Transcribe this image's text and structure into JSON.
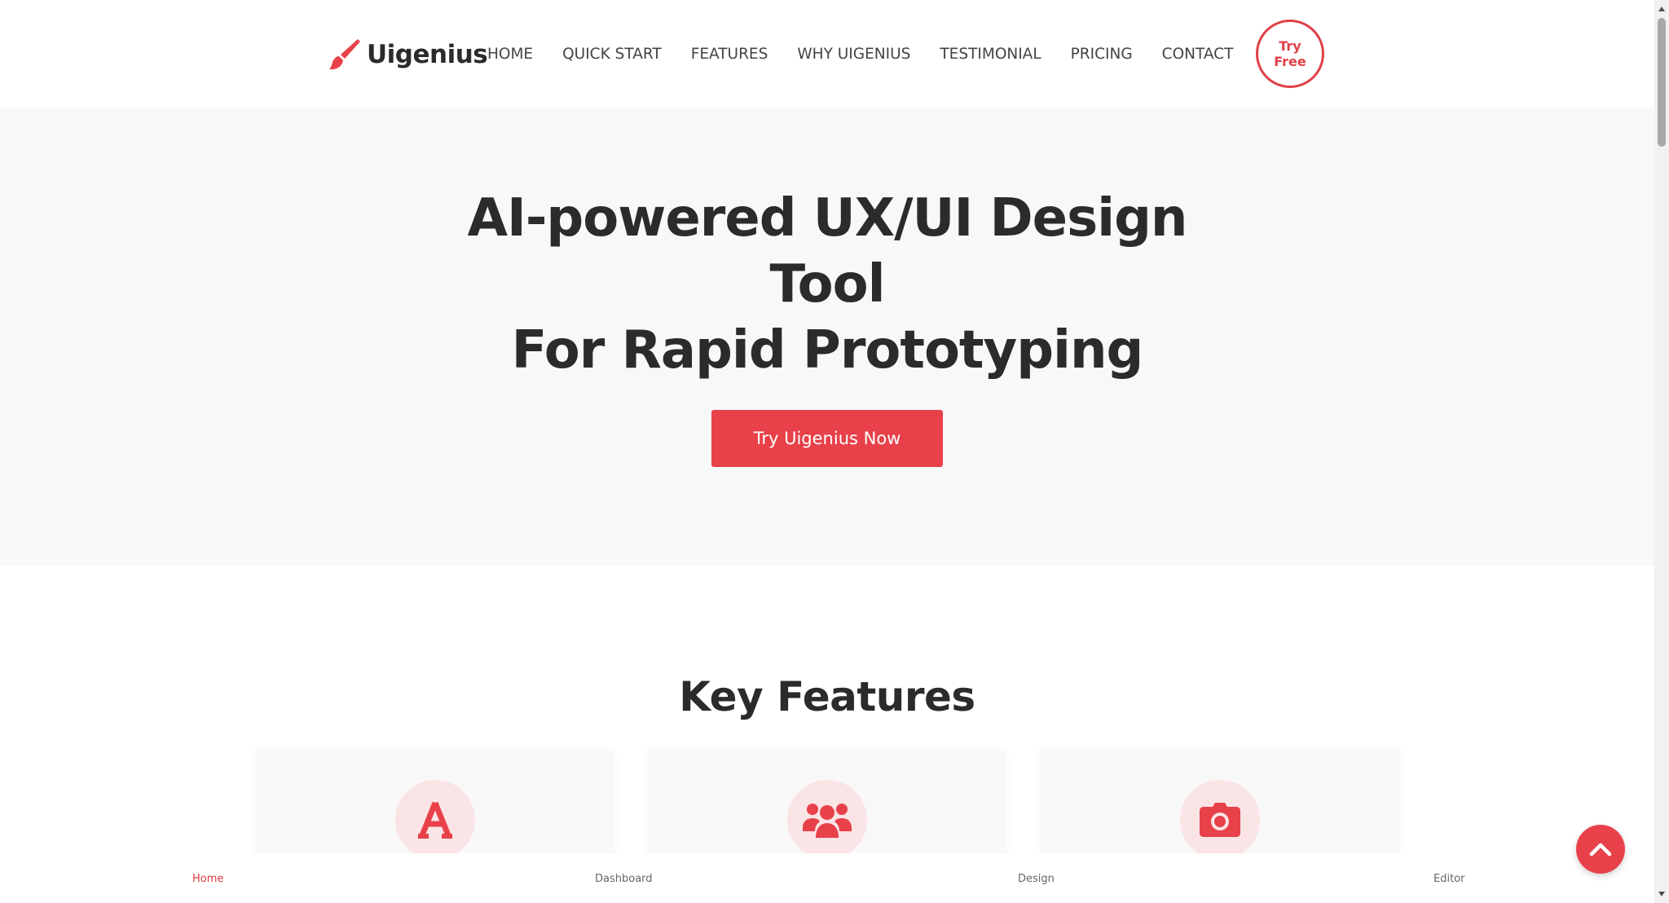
{
  "brand": {
    "name": "Uigenius",
    "accent_color": "#e8414a",
    "logo_icon": "paintbrush-icon"
  },
  "nav": {
    "items": [
      {
        "label": "HOME"
      },
      {
        "label": "QUICK START"
      },
      {
        "label": "FEATURES"
      },
      {
        "label": "WHY UIGENIUS"
      },
      {
        "label": "TESTIMONIAL"
      },
      {
        "label": "PRICING"
      },
      {
        "label": "CONTACT"
      }
    ],
    "try_free_label": "Try Free"
  },
  "hero": {
    "title_line1": "AI-powered UX/UI Design Tool",
    "title_line2": "For Rapid Prototyping",
    "cta_label": "Try Uigenius Now"
  },
  "features": {
    "title": "Key Features",
    "cards": [
      {
        "icon": "font-a-icon"
      },
      {
        "icon": "users-icon"
      },
      {
        "icon": "camera-icon"
      }
    ]
  },
  "tabbar": {
    "items": [
      {
        "label": "Home",
        "active": true
      },
      {
        "label": "Dashboard",
        "active": false
      },
      {
        "label": "Design",
        "active": false
      },
      {
        "label": "Editor",
        "active": false
      }
    ]
  },
  "scroll_top": {
    "icon": "chevron-up-icon"
  }
}
